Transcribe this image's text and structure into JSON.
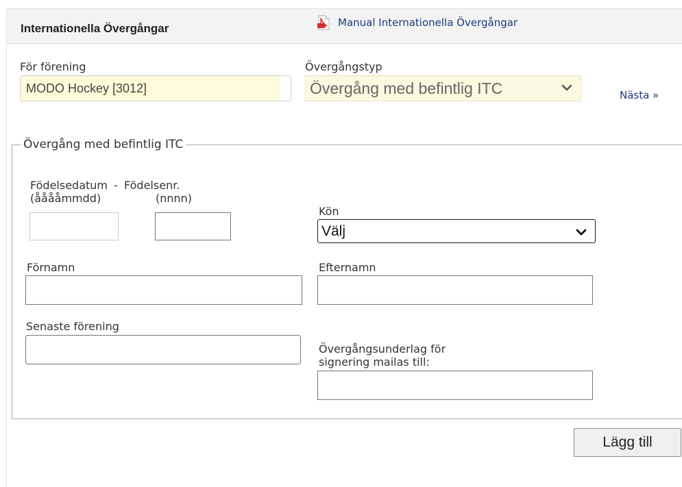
{
  "header": {
    "title": "Internationella Övergångar",
    "manual_link": "Manual Internationella Övergångar"
  },
  "top": {
    "club_label": "För förening",
    "club_value": "MODO Hockey [3012]",
    "type_label": "Övergångstyp",
    "type_value": "Övergång med befintlig ITC",
    "next_link": "Nästa »"
  },
  "form": {
    "legend": "Övergång med befintlig ITC",
    "birthdate_label_1": "Födelsedatum",
    "birthdate_label_2": "(ååååmmdd)",
    "dash": "-",
    "birthnr_label_1": "Födelsenr.",
    "birthnr_label_2": "(nnnn)",
    "gender_label": "Kön",
    "gender_value": "Välj",
    "firstname_label": "Förnamn",
    "lastname_label": "Efternamn",
    "last_club_label": "Senaste förening",
    "email_label_1": "Övergångsunderlag för",
    "email_label_2": "signering mailas till:"
  },
  "actions": {
    "add_label": "Lägg till"
  },
  "icons": {
    "manual": "pdf-icon",
    "select_arrow": "chevron-down-icon"
  },
  "colors": {
    "link": "#1a3a7a",
    "field_highlight": "#fdfbd9",
    "pdf_red": "#d32f2f"
  }
}
